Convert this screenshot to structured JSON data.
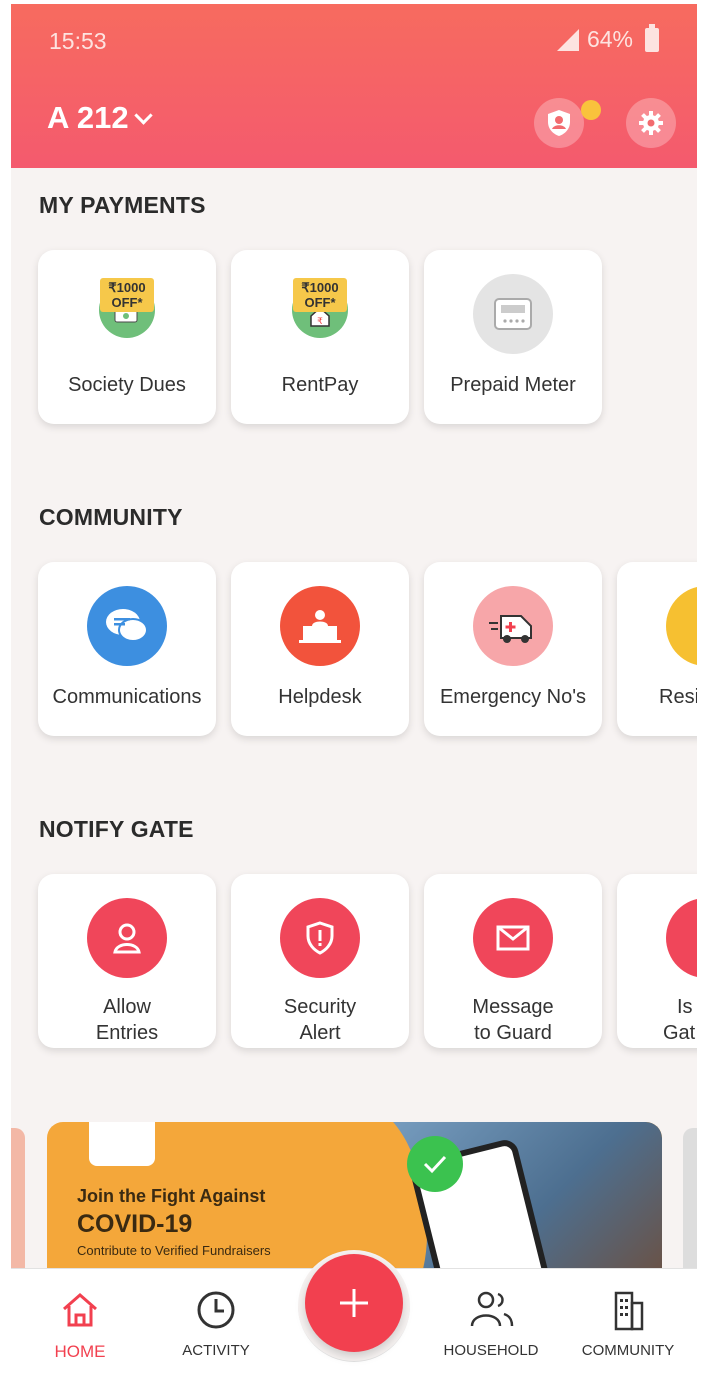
{
  "status_bar": {
    "time": "15:53",
    "battery": "64%"
  },
  "header": {
    "flat": "A 212",
    "icons": [
      "shield-person-icon",
      "gear-icon"
    ],
    "accent": "#f45a6e"
  },
  "payments": {
    "title": "MY PAYMENTS",
    "items": [
      {
        "label": "Society Dues",
        "offer": "₹1000 OFF*",
        "icon": "cash-icon",
        "color": "#6fbf7a"
      },
      {
        "label": "RentPay",
        "offer": "₹1000 OFF*",
        "icon": "house-rupee-icon",
        "color": "#6fbf7a"
      },
      {
        "label": "Prepaid Meter",
        "icon": "meter-icon",
        "color": "#e4e4e4"
      }
    ]
  },
  "community": {
    "title": "COMMUNITY",
    "items": [
      {
        "label": "Communications",
        "icon": "chat-bubbles-icon",
        "color": "#3d8fe0"
      },
      {
        "label": "Helpdesk",
        "icon": "helpdesk-icon",
        "color": "#f2533c"
      },
      {
        "label": "Emergency No's",
        "icon": "ambulance-icon",
        "color": "#f7a6a9"
      },
      {
        "label": "Resi",
        "icon": "laptop-icon",
        "color": "#f6c031"
      }
    ]
  },
  "notify_gate": {
    "title": "NOTIFY GATE",
    "items": [
      {
        "line1": "Allow",
        "line2": "Entries",
        "icon": "person-icon",
        "color": "#f0465a"
      },
      {
        "line1": "Security",
        "line2": "Alert",
        "icon": "shield-alert-icon",
        "color": "#f0465a"
      },
      {
        "line1": "Message",
        "line2": "to Guard",
        "icon": "envelope-icon",
        "color": "#f0465a"
      },
      {
        "line1": "Is",
        "line2": "Gat",
        "icon": "speaker-icon",
        "color": "#f0465a"
      }
    ]
  },
  "banner": {
    "line1": "Join the Fight Against",
    "line2": "COVID-19",
    "line3": "Contribute to Verified Fundraisers",
    "bg_color": "#f4a73a"
  },
  "bottom_nav": {
    "items": [
      {
        "label": "HOME",
        "icon": "home-icon",
        "active": true
      },
      {
        "label": "ACTIVITY",
        "icon": "clock-icon",
        "active": false
      },
      {
        "label": "HOUSEHOLD",
        "icon": "people-icon",
        "active": false
      },
      {
        "label": "COMMUNITY",
        "icon": "building-icon",
        "active": false
      }
    ],
    "fab_icon": "plus-icon",
    "active_color": "#f2404f"
  }
}
